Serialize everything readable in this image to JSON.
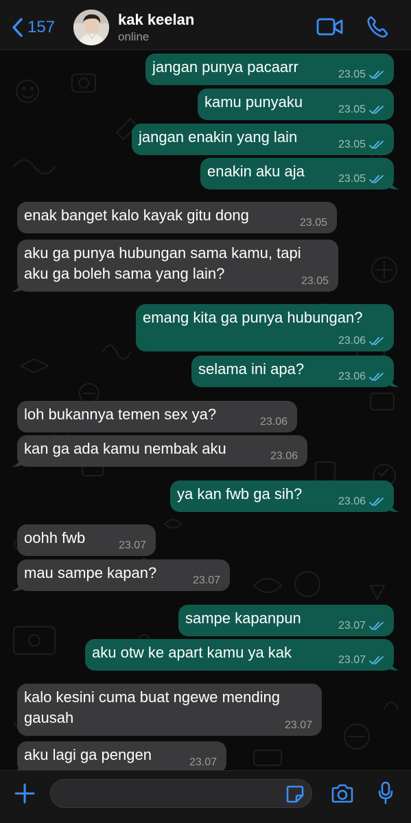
{
  "header": {
    "back_count": "157",
    "contact_name": "kak keelan",
    "status": "online"
  },
  "icons": {
    "back": "chevron-left-icon",
    "video": "video-camera-icon",
    "call": "phone-icon",
    "attach": "plus-icon",
    "sticker": "sticker-icon",
    "camera": "camera-icon",
    "mic": "microphone-icon"
  },
  "colors": {
    "accent": "#3b8df5",
    "outgoing_bubble": "#0f5a4d",
    "incoming_bubble": "#3a3a3c",
    "read_ticks": "#53bdeb"
  },
  "messages": [
    {
      "dir": "out",
      "text": "jangan punya pacaarr",
      "time": "23.05",
      "read": true
    },
    {
      "dir": "out",
      "text": "kamu punyaku",
      "time": "23.05",
      "read": true
    },
    {
      "dir": "out",
      "text": "jangan enakin yang lain",
      "time": "23.05",
      "read": true
    },
    {
      "dir": "out",
      "text": "enakin aku aja",
      "time": "23.05",
      "read": true
    },
    {
      "dir": "in",
      "text": "enak banget kalo kayak gitu dong",
      "time": "23.05"
    },
    {
      "dir": "in",
      "text": "aku ga punya hubungan sama kamu, tapi\naku ga boleh sama yang lain?",
      "time": "23.05"
    },
    {
      "dir": "out",
      "text": "emang kita ga punya hubungan?",
      "time": "23.06",
      "read": true
    },
    {
      "dir": "out",
      "text": "selama ini apa?",
      "time": "23.06",
      "read": true
    },
    {
      "dir": "in",
      "text": "loh bukannya temen sex ya?",
      "time": "23.06"
    },
    {
      "dir": "in",
      "text": "kan ga ada kamu nembak aku",
      "time": "23.06"
    },
    {
      "dir": "out",
      "text": "ya kan fwb ga sih?",
      "time": "23.06",
      "read": true
    },
    {
      "dir": "in",
      "text": "oohh fwb",
      "time": "23.07"
    },
    {
      "dir": "in",
      "text": "mau sampe kapan?",
      "time": "23.07"
    },
    {
      "dir": "out",
      "text": "sampe kapanpun",
      "time": "23.07",
      "read": true
    },
    {
      "dir": "out",
      "text": "aku otw ke apart kamu ya kak",
      "time": "23.07",
      "read": true
    },
    {
      "dir": "in",
      "text": "kalo kesini cuma buat ngewe mending\ngausah",
      "time": "23.07"
    },
    {
      "dir": "in",
      "text": "aku lagi ga pengen",
      "time": "23.07"
    }
  ],
  "composer": {
    "value": "",
    "placeholder": ""
  }
}
